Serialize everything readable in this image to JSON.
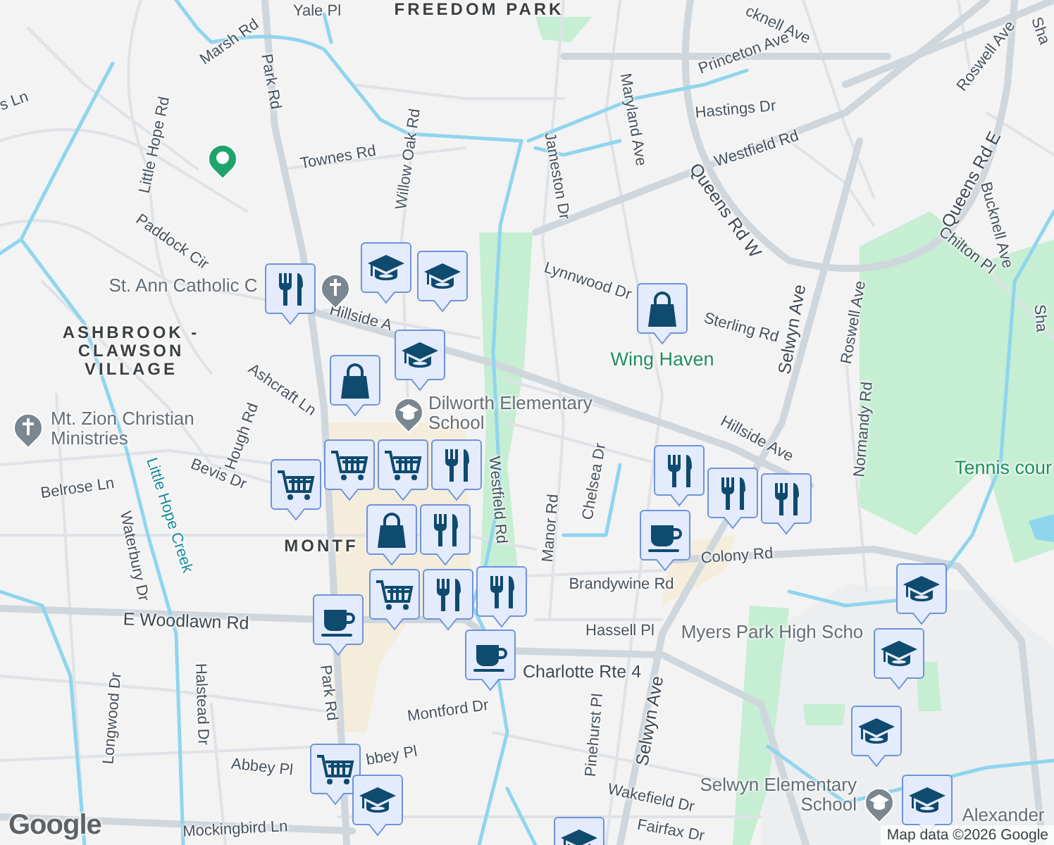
{
  "map": {
    "labels": [
      {
        "text": "Yale Pl",
        "kind": "street"
      },
      {
        "text": "FREEDOM PARK",
        "kind": "district"
      },
      {
        "text": "Marsh Rd",
        "kind": "street"
      },
      {
        "text": "Park Rd",
        "kind": "street"
      },
      {
        "text": "s Ln",
        "kind": "street"
      },
      {
        "text": "Little Hope Rd",
        "kind": "street"
      },
      {
        "text": "Townes Rd",
        "kind": "street"
      },
      {
        "text": "Willow Oak Rd",
        "kind": "street"
      },
      {
        "text": "Paddock Cir",
        "kind": "street"
      },
      {
        "text": "St. Ann Catholic C",
        "kind": "place"
      },
      {
        "text": "Hillside A",
        "kind": "street"
      },
      {
        "text": "ASHBROOK - CLAWSON VILLAGE",
        "kind": "district"
      },
      {
        "text": "Ashcraft Ln",
        "kind": "street"
      },
      {
        "text": "Hough Rd",
        "kind": "street"
      },
      {
        "text": "Mt. Zion Christian Ministries",
        "kind": "place"
      },
      {
        "text": "Dilworth Elementary School",
        "kind": "place"
      },
      {
        "text": "Belrose Ln",
        "kind": "street"
      },
      {
        "text": "Bevis Dr",
        "kind": "street"
      },
      {
        "text": "Little Hope Creek",
        "kind": "creek"
      },
      {
        "text": "Waterbury Dr",
        "kind": "street"
      },
      {
        "text": "MONTF",
        "kind": "district"
      },
      {
        "text": "E Woodlawn Rd",
        "kind": "major"
      },
      {
        "text": "Longwood Dr",
        "kind": "street"
      },
      {
        "text": "Halstead Dr",
        "kind": "street"
      },
      {
        "text": "Park Rd",
        "kind": "street"
      },
      {
        "text": "Montford Dr",
        "kind": "street"
      },
      {
        "text": "Abbey Pl",
        "kind": "street"
      },
      {
        "text": "bbey Pl",
        "kind": "street"
      },
      {
        "text": "Mockingbird Ln",
        "kind": "street"
      },
      {
        "text": "Westfield Rd",
        "kind": "street"
      },
      {
        "text": "Manor Rd",
        "kind": "street"
      },
      {
        "text": "Chelsea Dr",
        "kind": "street"
      },
      {
        "text": "Hillside Ave",
        "kind": "street"
      },
      {
        "text": "Colony Rd",
        "kind": "street"
      },
      {
        "text": "Brandywine Rd",
        "kind": "street"
      },
      {
        "text": "Hassell Pl",
        "kind": "street"
      },
      {
        "text": "Charlotte Rte 4",
        "kind": "major"
      },
      {
        "text": "Pinehurst Pl",
        "kind": "street"
      },
      {
        "text": "Selwyn Ave",
        "kind": "major"
      },
      {
        "text": "Wakefield Dr",
        "kind": "street"
      },
      {
        "text": "Fairfax Dr",
        "kind": "street"
      },
      {
        "text": "Normandy Rd",
        "kind": "street"
      },
      {
        "text": "Jameston Dr",
        "kind": "street"
      },
      {
        "text": "Maryland Ave",
        "kind": "street"
      },
      {
        "text": "cknell Ave",
        "kind": "street"
      },
      {
        "text": "Princeton Ave",
        "kind": "street"
      },
      {
        "text": "Hastings Dr",
        "kind": "street"
      },
      {
        "text": "Westfield Rd",
        "kind": "street"
      },
      {
        "text": "Queens Rd W",
        "kind": "major"
      },
      {
        "text": "Lynnwood Dr",
        "kind": "street"
      },
      {
        "text": "Sterling Rd",
        "kind": "street"
      },
      {
        "text": "Selwyn Ave",
        "kind": "major"
      },
      {
        "text": "Roswell Ave",
        "kind": "street"
      },
      {
        "text": "Wing Haven",
        "kind": "park"
      },
      {
        "text": "Roswell Ave",
        "kind": "street"
      },
      {
        "text": "Queens Rd E",
        "kind": "major"
      },
      {
        "text": "Bucknell Ave",
        "kind": "street"
      },
      {
        "text": "Chilton Pl",
        "kind": "street"
      },
      {
        "text": "Sha",
        "kind": "street"
      },
      {
        "text": "Sha",
        "kind": "street"
      },
      {
        "text": "Tennis cour",
        "kind": "park"
      },
      {
        "text": "Myers Park High Scho",
        "kind": "place"
      },
      {
        "text": "Selwyn Elementary School",
        "kind": "place"
      },
      {
        "text": "Alexander",
        "kind": "place"
      }
    ],
    "markers": [
      {
        "kind": "place"
      },
      {
        "kind": "restaurant"
      },
      {
        "kind": "church"
      },
      {
        "kind": "school"
      },
      {
        "kind": "school"
      },
      {
        "kind": "school"
      },
      {
        "kind": "school-dot"
      },
      {
        "kind": "shopping"
      },
      {
        "kind": "church"
      },
      {
        "kind": "grocery"
      },
      {
        "kind": "grocery"
      },
      {
        "kind": "restaurant"
      },
      {
        "kind": "grocery"
      },
      {
        "kind": "shopping"
      },
      {
        "kind": "restaurant"
      },
      {
        "kind": "grocery"
      },
      {
        "kind": "restaurant"
      },
      {
        "kind": "restaurant"
      },
      {
        "kind": "cafe"
      },
      {
        "kind": "cafe"
      },
      {
        "kind": "shopping"
      },
      {
        "kind": "restaurant"
      },
      {
        "kind": "restaurant"
      },
      {
        "kind": "restaurant"
      },
      {
        "kind": "cafe"
      },
      {
        "kind": "school"
      },
      {
        "kind": "school"
      },
      {
        "kind": "school"
      },
      {
        "kind": "school-dot"
      },
      {
        "kind": "school"
      },
      {
        "kind": "grocery"
      },
      {
        "kind": "school"
      },
      {
        "kind": "school"
      }
    ]
  },
  "attribution": {
    "logo": "Google",
    "text": "Map data ©2026 Google"
  }
}
